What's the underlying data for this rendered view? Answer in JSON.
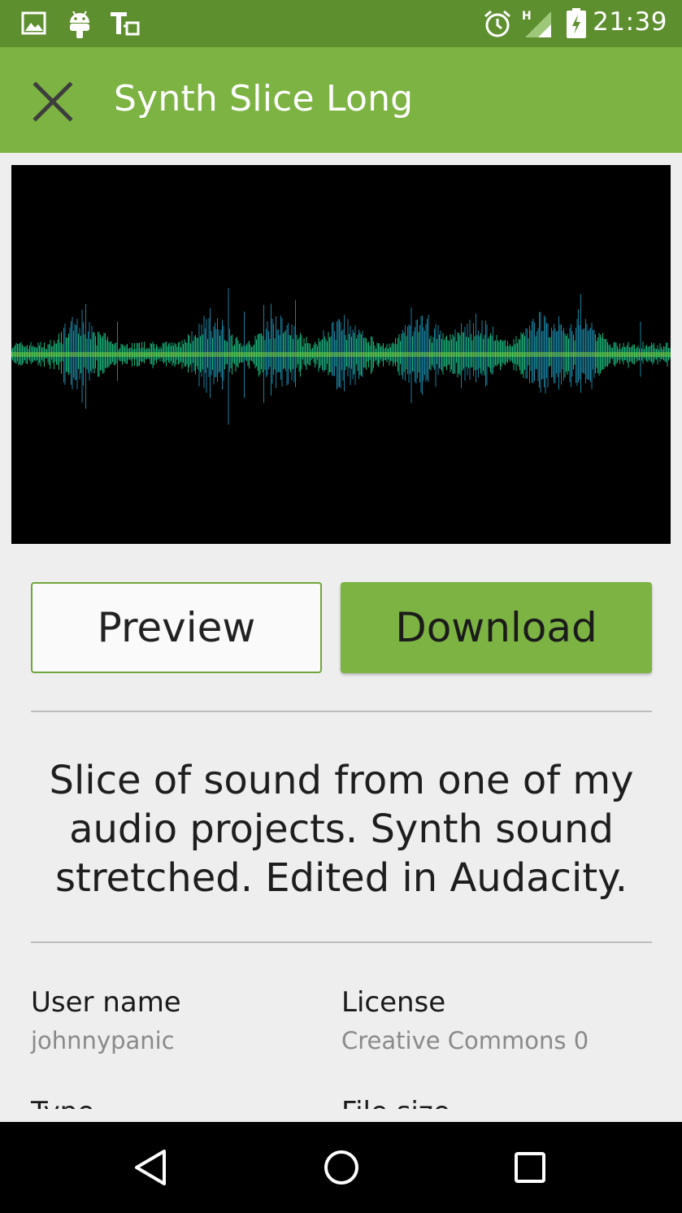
{
  "status_bar": {
    "time": "21:39",
    "icons": [
      "image-icon",
      "android-icon",
      "translate-icon",
      "alarm-icon",
      "signal-h-icon",
      "battery-charging-icon"
    ]
  },
  "app_bar": {
    "title": "Synth Slice Long",
    "close_icon": "close-icon"
  },
  "waveform": {
    "colors": {
      "background": "#000000",
      "peak": "#1a8fb0",
      "mid": "#19c98a",
      "center": "#8ee23a"
    }
  },
  "actions": {
    "preview_label": "Preview",
    "download_label": "Download"
  },
  "description": "Slice of sound from one of my audio projects. Synth sound stretched. Edited in Audacity.",
  "details": {
    "user_name_label": "User name",
    "user_name_value": "johnnypanic",
    "license_label": "License",
    "license_value": "Creative Commons 0",
    "type_label": "Type",
    "file_size_label": "File size"
  },
  "nav_bar": {
    "back_icon": "back-icon",
    "home_icon": "home-icon",
    "recents_icon": "recents-icon"
  },
  "colors": {
    "status_bar": "#5e8f2f",
    "app_bar": "#7cb342",
    "accent": "#7cb342",
    "background": "#eeeeee"
  }
}
